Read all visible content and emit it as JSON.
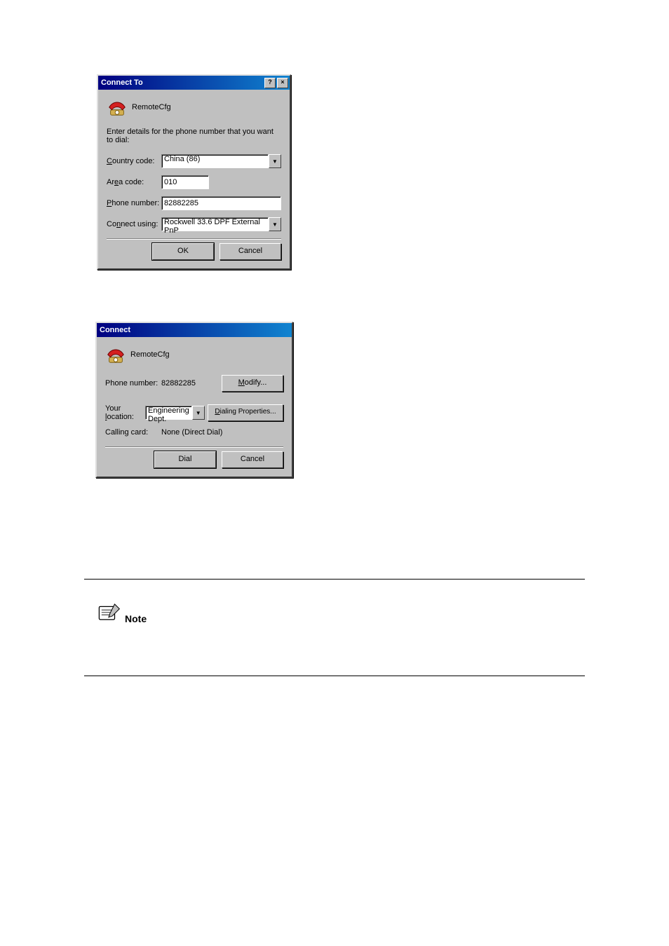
{
  "dialog1": {
    "title": "Connect To",
    "connection_name": "RemoteCfg",
    "instruction": "Enter details for the phone number that you want to dial:",
    "labels": {
      "country_code": "Country code:",
      "area_code": "Area code:",
      "phone_number": "Phone number:",
      "connect_using": "Connect using:"
    },
    "values": {
      "country_code": "China (86)",
      "area_code": "010",
      "phone_number": "82882285",
      "connect_using": "Rockwell 33.6 DPF External PnP"
    },
    "buttons": {
      "ok": "OK",
      "cancel": "Cancel"
    }
  },
  "dialog2": {
    "title": "Connect",
    "connection_name": "RemoteCfg",
    "labels": {
      "phone_number": "Phone number:",
      "your_location": "Your location:",
      "calling_card": "Calling card:"
    },
    "values": {
      "phone_number": "82882285",
      "your_location": "Engineering Dept.",
      "calling_card": "None (Direct Dial)"
    },
    "buttons": {
      "modify": "Modify...",
      "dialing_properties": "Dialing Properties...",
      "dial": "Dial",
      "cancel": "Cancel"
    }
  },
  "note_label": "Note"
}
